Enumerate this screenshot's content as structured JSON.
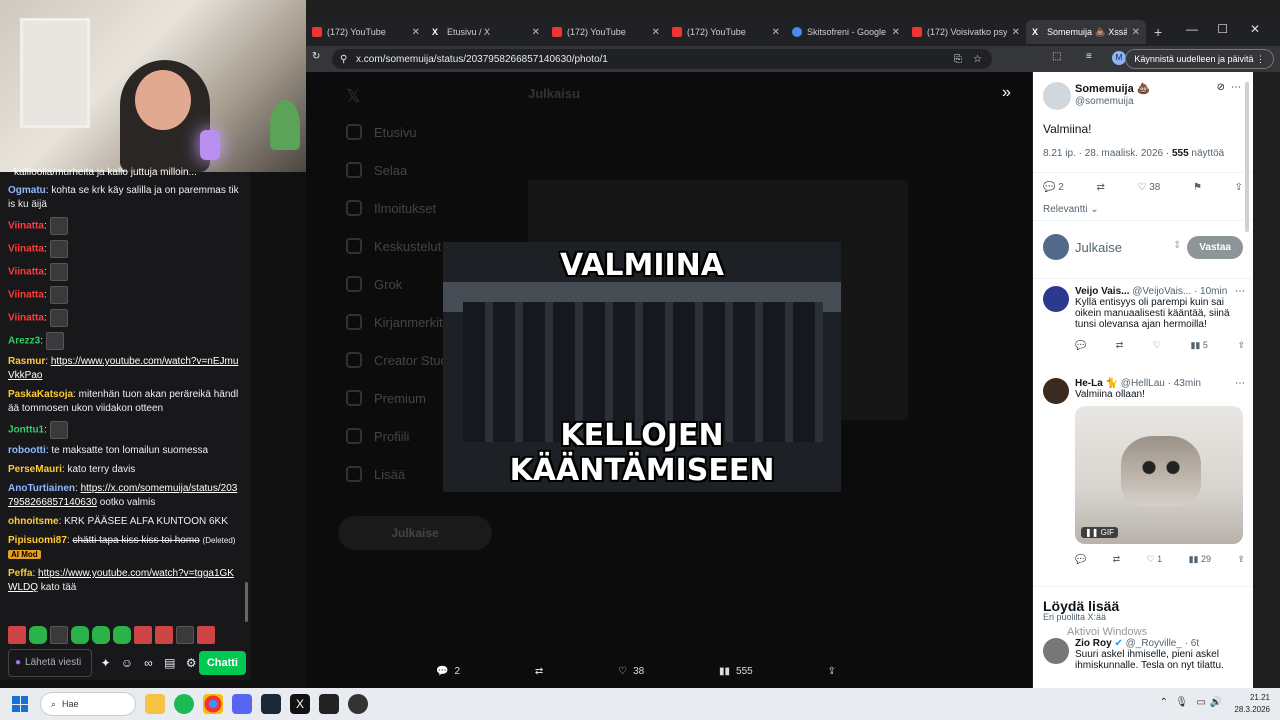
{
  "chat": {
    "cut_top": "kallloolla/murheita ja kallo juttuja milloin...",
    "messages": [
      {
        "user": "Ogmatu",
        "color": "#8fb8ff",
        "text": "kohta se krk käy salilla ja on paremmas tikis ku äijä"
      },
      {
        "user": "Viinatta",
        "color": "#ff3b3b",
        "text": ""
      },
      {
        "user": "Viinatta",
        "color": "#ff3b3b",
        "text": ""
      },
      {
        "user": "Viinatta",
        "color": "#ff3b3b",
        "text": ""
      },
      {
        "user": "Viinatta",
        "color": "#ff3b3b",
        "text": ""
      },
      {
        "user": "Viinatta",
        "color": "#ff3b3b",
        "text": ""
      },
      {
        "user": "Arezz3",
        "color": "#33cc66",
        "text": ""
      },
      {
        "user": "Rasmur",
        "color": "#ffcc33",
        "link": "https://www.youtube.com/watch?v=nEJmuVkkPao",
        "text": ""
      },
      {
        "user": "PaskaKatsoja",
        "color": "#ffcc33",
        "text": "mitenhän tuon akan peräreikä händlää tommosen ukon viidakon otteen"
      },
      {
        "user": "Jonttu1",
        "color": "#33cc66",
        "text": ""
      },
      {
        "user": "robootti",
        "color": "#8fb8ff",
        "text": "te maksatte ton lomailun suomessa"
      },
      {
        "user": "PerseMauri",
        "color": "#ffcc33",
        "text": "kato terry davis"
      },
      {
        "user": "AnoTurtiainen",
        "color": "#8fb8ff",
        "link": "https://x.com/somemuija/status/2037958266857140630",
        "text": "ootko valmis"
      },
      {
        "user": "ohnoitsme",
        "color": "#ffcc33",
        "text": "KRK PÄÄSEE ALFA KUNTOON 6KK"
      },
      {
        "user": "Pipisuomi87",
        "color": "#ffcc33",
        "text": "chätti tapa kiss kiss toi homo",
        "deleted": "(Deleted)",
        "badge": "AI Mod"
      },
      {
        "user": "Peffa",
        "color": "#ffcc33",
        "link": "https://www.youtube.com/watch?v=tgga1GKWLDQ",
        "text": "kato tää"
      }
    ],
    "input_placeholder": "Lähetä viesti",
    "send_label": "Chatti"
  },
  "browser": {
    "tabs": [
      {
        "title": "(172) YouTube",
        "icon": "youtube-icon"
      },
      {
        "title": "Etusivu / X",
        "icon": "x-icon"
      },
      {
        "title": "(172) YouTube",
        "icon": "youtube-icon"
      },
      {
        "title": "(172) YouTube",
        "icon": "youtube-icon"
      },
      {
        "title": "Skitsofreni - Google",
        "icon": "google-icon"
      },
      {
        "title": "(172) Voisivatko psy",
        "icon": "youtube-icon"
      },
      {
        "title": "Somemuija 💩 Xssä",
        "icon": "x-icon",
        "active": true
      }
    ],
    "url": "x.com/somemuija/status/2037958266857140630/photo/1",
    "restart_label": "Käynnistä uudelleen ja päivitä",
    "profile_initial": "M"
  },
  "page": {
    "nav": [
      "Etusivu",
      "Selaa",
      "Ilmoitukset",
      "Keskustelut",
      "Grok",
      "Kirjanmerkit",
      "Creator Studio",
      "Premium",
      "Profiili",
      "Lisää"
    ],
    "post_button": "Julkaise",
    "header": "Julkaisu",
    "image": {
      "top_caption": "VALMIINA",
      "bottom_caption": "KELLOJEN KÄÄNTÄMISEEN"
    },
    "bottom": {
      "replies": "2",
      "likes": "38",
      "views": "555"
    }
  },
  "sidebar": {
    "author": {
      "name": "Somemuija 💩",
      "handle": "@somemuija"
    },
    "tweet_text": "Valmiina!",
    "meta_time": "8.21 ip. · 28. maalisk. 2026 · ",
    "meta_views": "555",
    "meta_views_label": " näyttöä",
    "stats": {
      "replies": "2",
      "likes": "38"
    },
    "sort_label": "Relevantti",
    "reply_placeholder": "Julkaise",
    "reply_button": "Vastaa",
    "replies": [
      {
        "name": "Veijo Vais...",
        "handle": "@VeijoVais...",
        "time": "· 10min",
        "text": "Kyllä entisyys oli parempi kuin sai oikein manuaalisesti kääntää, siinä tunsi olevansa ajan hermoilla!",
        "views": "5"
      },
      {
        "name": "He-La 🐈",
        "handle": "@HellLau",
        "time": "· 43min",
        "text": "Valmiina ollaan!",
        "likes": "1",
        "views": "29",
        "gif_label": "GIF"
      }
    ],
    "explore_title": "Löydä lisää",
    "explore_sub": "Eri puolilta X:ää",
    "watermark": "Aktivoi Windows",
    "third": {
      "name": "Zio Roy",
      "handle": "@_Royville_",
      "time": "· 6t",
      "text": "Suuri askel ihmiselle, pieni askel ihmiskunnalle. Tesla on nyt tilattu."
    }
  },
  "taskbar": {
    "search": "Hae",
    "time": "21.21",
    "date": "28.3.2026"
  }
}
